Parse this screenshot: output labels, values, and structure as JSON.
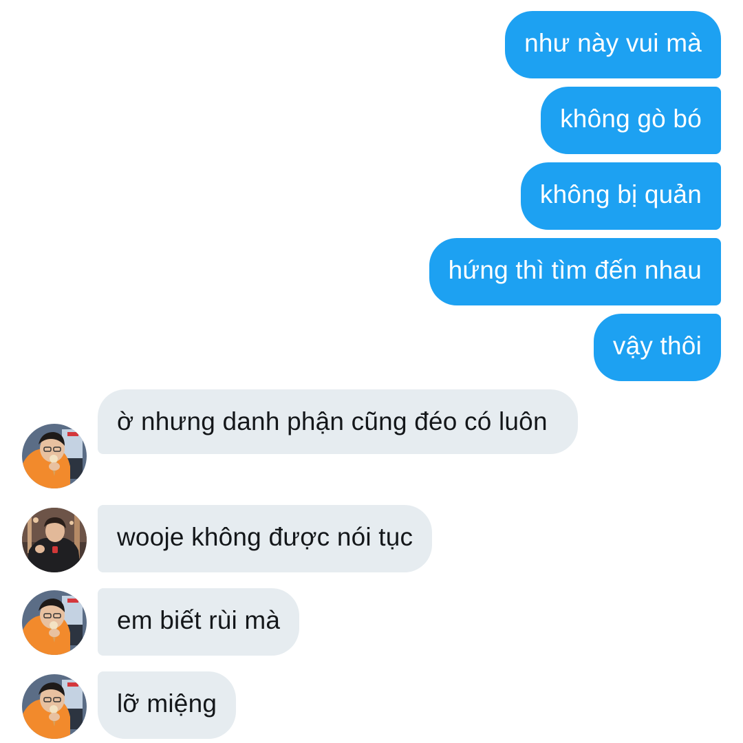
{
  "conversation": {
    "outgoing": [
      {
        "text": "như này vui mà"
      },
      {
        "text": "không gò bó"
      },
      {
        "text": "không bị quản"
      },
      {
        "text": "hứng thì tìm đến nhau"
      },
      {
        "text": "vậy thôi"
      }
    ],
    "incoming": [
      {
        "text": "ờ nhưng danh phận cũng đéo có luôn",
        "avatar": "orange-hoodie-avatar"
      },
      {
        "text": "wooje không được nói tục",
        "avatar": "dark-jacket-avatar"
      },
      {
        "text": "em biết rùi mà",
        "avatar": "orange-hoodie-avatar"
      },
      {
        "text": "lỡ miệng",
        "avatar": "orange-hoodie-avatar"
      }
    ]
  },
  "colors": {
    "outgoing_bubble": "#1da1f2",
    "incoming_bubble": "#e6ecf0",
    "outgoing_text": "#ffffff",
    "incoming_text": "#14171a"
  }
}
